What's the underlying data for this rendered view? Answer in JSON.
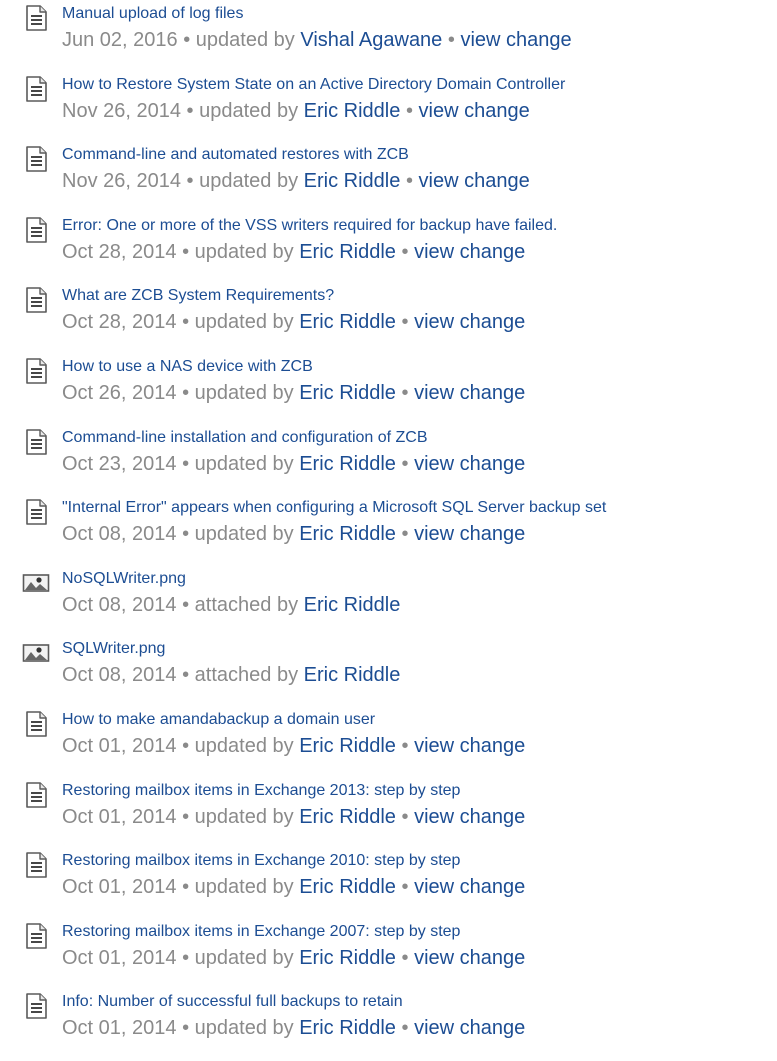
{
  "activity": {
    "items": [
      {
        "type": "page",
        "title": "Manual upload of log files",
        "date": "Jun 02, 2016",
        "action": "updated by",
        "user": "Vishal Agawane",
        "change_link": "view change"
      },
      {
        "type": "page",
        "title": "How to Restore System State on an Active Directory Domain Controller",
        "date": "Nov 26, 2014",
        "action": "updated by",
        "user": "Eric Riddle",
        "change_link": "view change"
      },
      {
        "type": "page",
        "title": "Command-line and automated restores with ZCB",
        "date": "Nov 26, 2014",
        "action": "updated by",
        "user": "Eric Riddle",
        "change_link": "view change"
      },
      {
        "type": "page",
        "title": "Error: One or more of the VSS writers required for backup have failed.",
        "date": "Oct 28, 2014",
        "action": "updated by",
        "user": "Eric Riddle",
        "change_link": "view change"
      },
      {
        "type": "page",
        "title": "What are ZCB System Requirements?",
        "date": "Oct 28, 2014",
        "action": "updated by",
        "user": "Eric Riddle",
        "change_link": "view change"
      },
      {
        "type": "page",
        "title": "How to use a NAS device with ZCB",
        "date": "Oct 26, 2014",
        "action": "updated by",
        "user": "Eric Riddle",
        "change_link": "view change"
      },
      {
        "type": "page",
        "title": "Command-line installation and configuration of ZCB",
        "date": "Oct 23, 2014",
        "action": "updated by",
        "user": "Eric Riddle",
        "change_link": "view change"
      },
      {
        "type": "page",
        "title": "\"Internal Error\" appears when configuring a Microsoft SQL Server backup set",
        "date": "Oct 08, 2014",
        "action": "updated by",
        "user": "Eric Riddle",
        "change_link": "view change"
      },
      {
        "type": "image",
        "title": "NoSQLWriter.png",
        "date": "Oct 08, 2014",
        "action": "attached by",
        "user": "Eric Riddle",
        "change_link": null
      },
      {
        "type": "image",
        "title": "SQLWriter.png",
        "date": "Oct 08, 2014",
        "action": "attached by",
        "user": "Eric Riddle",
        "change_link": null
      },
      {
        "type": "page",
        "title": "How to make amandabackup a domain user",
        "date": "Oct 01, 2014",
        "action": "updated by",
        "user": "Eric Riddle",
        "change_link": "view change"
      },
      {
        "type": "page",
        "title": "Restoring mailbox items in Exchange 2013: step by step",
        "date": "Oct 01, 2014",
        "action": "updated by",
        "user": "Eric Riddle",
        "change_link": "view change"
      },
      {
        "type": "page",
        "title": "Restoring mailbox items in Exchange 2010: step by step",
        "date": "Oct 01, 2014",
        "action": "updated by",
        "user": "Eric Riddle",
        "change_link": "view change"
      },
      {
        "type": "page",
        "title": "Restoring mailbox items in Exchange 2007: step by step",
        "date": "Oct 01, 2014",
        "action": "updated by",
        "user": "Eric Riddle",
        "change_link": "view change"
      },
      {
        "type": "page",
        "title": "Info: Number of successful full backups to retain",
        "date": "Oct 01, 2014",
        "action": "updated by",
        "user": "Eric Riddle",
        "change_link": "view change"
      }
    ],
    "separator": "•",
    "colors": {
      "link": "#1c4d93",
      "meta": "#8a8a8a"
    },
    "icons": {
      "page": "page-document-icon",
      "image": "image-attachment-icon"
    }
  }
}
